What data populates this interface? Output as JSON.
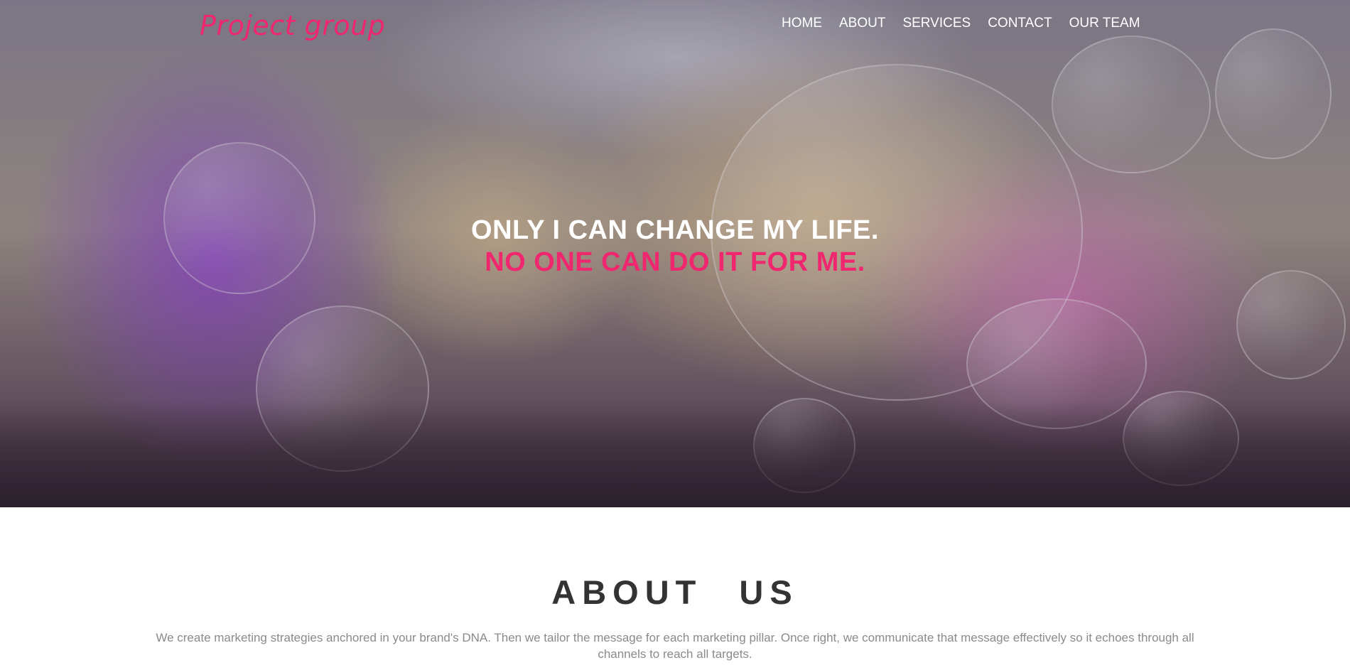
{
  "brand": {
    "logo_text": "Project group",
    "accent_color": "#f0266f"
  },
  "nav": {
    "items": [
      {
        "label": "HOME"
      },
      {
        "label": "ABOUT"
      },
      {
        "label": "SERVICES"
      },
      {
        "label": "CONTACT"
      },
      {
        "label": "OUR TEAM"
      }
    ]
  },
  "hero": {
    "line1": "ONLY I CAN CHANGE MY LIFE.",
    "line2": "NO ONE CAN DO IT FOR ME."
  },
  "about": {
    "title": "ABOUT US",
    "text": "We create marketing strategies anchored in your brand's DNA. Then we tailor the message for each marketing pillar. Once right, we communicate that message effectively so it echoes through all channels to reach all targets."
  }
}
